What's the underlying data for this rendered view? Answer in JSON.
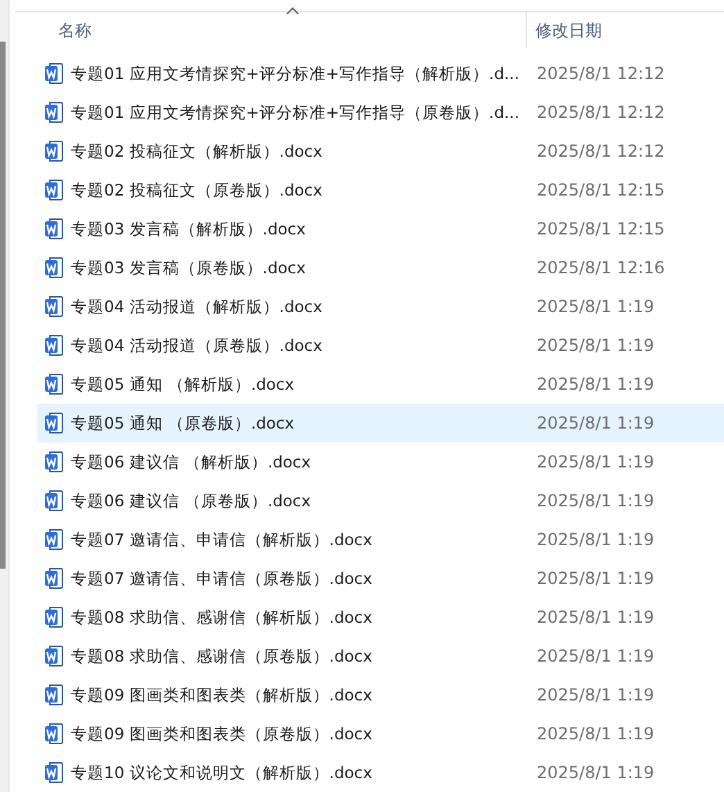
{
  "columns": [
    {
      "label": "名称",
      "sorted": true
    },
    {
      "label": "修改日期",
      "sorted": false
    }
  ],
  "files": [
    {
      "name": "专题01 应用文考情探究+评分标准+写作指导（解析版）.d...",
      "date": "2025/8/1 12:12",
      "hovered": false
    },
    {
      "name": "专题01 应用文考情探究+评分标准+写作指导（原卷版）.d...",
      "date": "2025/8/1 12:12",
      "hovered": false
    },
    {
      "name": "专题02 投稿征文（解析版）.docx",
      "date": "2025/8/1 12:12",
      "hovered": false
    },
    {
      "name": "专题02 投稿征文（原卷版）.docx",
      "date": "2025/8/1 12:15",
      "hovered": false
    },
    {
      "name": "专题03 发言稿（解析版）.docx",
      "date": "2025/8/1 12:15",
      "hovered": false
    },
    {
      "name": "专题03 发言稿（原卷版）.docx",
      "date": "2025/8/1 12:16",
      "hovered": false
    },
    {
      "name": "专题04 活动报道（解析版）.docx",
      "date": "2025/8/1 1:19",
      "hovered": false
    },
    {
      "name": "专题04 活动报道（原卷版）.docx",
      "date": "2025/8/1 1:19",
      "hovered": false
    },
    {
      "name": "专题05 通知 （解析版）.docx",
      "date": "2025/8/1 1:19",
      "hovered": false
    },
    {
      "name": "专题05 通知 （原卷版）.docx",
      "date": "2025/8/1 1:19",
      "hovered": true
    },
    {
      "name": "专题06 建议信 （解析版）.docx",
      "date": "2025/8/1 1:19",
      "hovered": false
    },
    {
      "name": "专题06 建议信 （原卷版）.docx",
      "date": "2025/8/1 1:19",
      "hovered": false
    },
    {
      "name": "专题07 邀请信、申请信（解析版）.docx",
      "date": "2025/8/1 1:19",
      "hovered": false
    },
    {
      "name": "专题07 邀请信、申请信（原卷版）.docx",
      "date": "2025/8/1 1:19",
      "hovered": false
    },
    {
      "name": "专题08 求助信、感谢信（解析版）.docx",
      "date": "2025/8/1 1:19",
      "hovered": false
    },
    {
      "name": "专题08 求助信、感谢信（原卷版）.docx",
      "date": "2025/8/1 1:19",
      "hovered": false
    },
    {
      "name": "专题09 图画类和图表类（解析版）.docx",
      "date": "2025/8/1 1:19",
      "hovered": false
    },
    {
      "name": "专题09 图画类和图表类（原卷版）.docx",
      "date": "2025/8/1 1:19",
      "hovered": false
    },
    {
      "name": "专题10 议论文和说明文（解析版）.docx",
      "date": "2025/8/1 1:19",
      "hovered": false
    }
  ]
}
